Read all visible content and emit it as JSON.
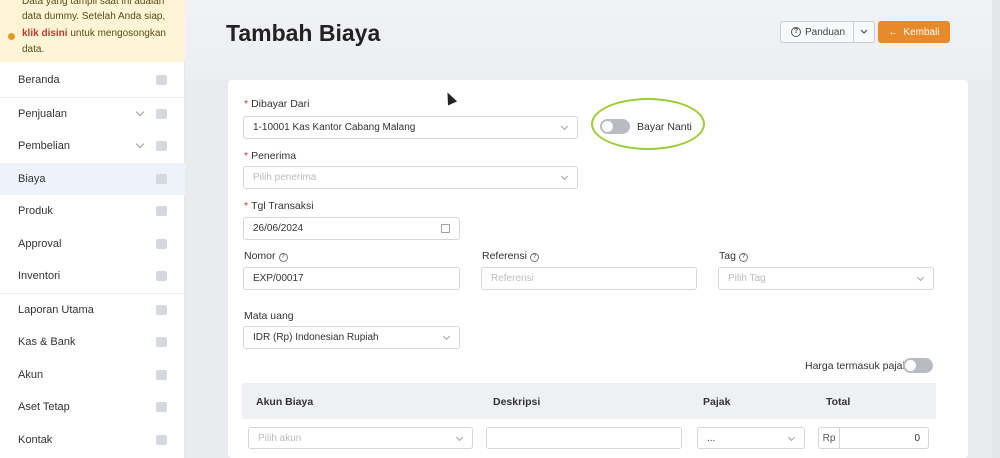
{
  "notice": {
    "line1": "Data yang tampil saat ini adalah",
    "line2": "data dummy. Setelah Anda siap,",
    "link": "klik disini",
    "line3_rest": " untuk mengosongkan",
    "line4": "data."
  },
  "sidebar": {
    "items": [
      {
        "label": "Beranda"
      },
      {
        "label": "Penjualan"
      },
      {
        "label": "Pembelian"
      },
      {
        "label": "Biaya"
      },
      {
        "label": "Produk"
      },
      {
        "label": "Approval"
      },
      {
        "label": "Inventori"
      },
      {
        "label": "Laporan Utama"
      },
      {
        "label": "Kas & Bank"
      },
      {
        "label": "Akun"
      },
      {
        "label": "Aset Tetap"
      },
      {
        "label": "Kontak"
      }
    ]
  },
  "header": {
    "title": "Tambah Biaya",
    "guide_label": "Panduan",
    "back_label": "Kembali"
  },
  "form": {
    "paid_from": {
      "label": "Dibayar Dari",
      "value": "1-10001 Kas Kantor Cabang Malang"
    },
    "pay_later": {
      "label": "Bayar Nanti"
    },
    "recipient": {
      "label": "Penerima",
      "placeholder": "Pilih penerima"
    },
    "date": {
      "label": "Tgl Transaksi",
      "value": "26/06/2024"
    },
    "number": {
      "label": "Nomor",
      "value": "EXP/00017"
    },
    "reference": {
      "label": "Referensi",
      "placeholder": "Referensi"
    },
    "tag": {
      "label": "Tag",
      "placeholder": "Pilih Tag"
    },
    "currency": {
      "label": "Mata uang",
      "value": "IDR (Rp) Indonesian Rupiah"
    },
    "tax_inclusive": {
      "label": "Harga termasuk pajak"
    }
  },
  "table": {
    "headers": [
      "Akun Biaya",
      "Deskripsi",
      "Pajak",
      "Total"
    ],
    "row": {
      "account_placeholder": "Pilih akun",
      "tax_value": "...",
      "currency_prefix": "Rp",
      "total": "0"
    }
  }
}
